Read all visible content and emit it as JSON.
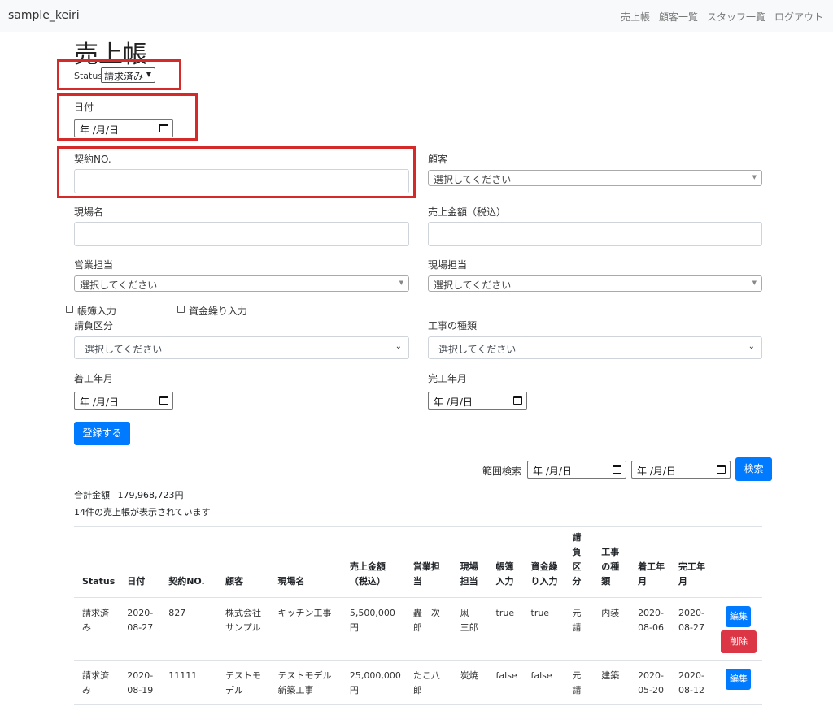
{
  "navbar": {
    "brand": "sample_keiri",
    "links": [
      "売上帳",
      "顧客一覧",
      "スタッフ一覧",
      "ログアウト"
    ]
  },
  "page_title": "売上帳",
  "status_filter": {
    "label": "Status",
    "value": "請求済み"
  },
  "form": {
    "date_label": "日付",
    "date_value": "年 /月/日",
    "contract_label": "契約NO.",
    "customer_label": "顧客",
    "customer_value": "選択してください",
    "site_label": "現場名",
    "amount_label": "売上金額（税込）",
    "sales_staff_label": "営業担当",
    "sales_staff_value": "選択してください",
    "site_staff_label": "現場担当",
    "site_staff_value": "選択してください",
    "ledger_check_label": "帳簿入力",
    "fund_check_label": "資金繰り入力",
    "contract_type_label": "請負区分",
    "contract_type_value": "選択してください",
    "work_type_label": "工事の種類",
    "work_type_value": "選択してください",
    "start_label": "着工年月",
    "start_value": "年 /月/日",
    "end_label": "完工年月",
    "end_value": "年 /月/日",
    "submit_label": "登録する"
  },
  "range_search": {
    "label": "範囲検索",
    "from_value": "年 /月/日",
    "to_value": "年 /月/日",
    "button_label": "検索"
  },
  "summary": {
    "total_label": "合計金額",
    "total_value": "179,968,723円",
    "count_text": "14件の売上帳が表示されています"
  },
  "table": {
    "headers": [
      "Status",
      "日付",
      "契約NO.",
      "顧客",
      "現場名",
      "売上金額（税込）",
      "営業担当",
      "現場担当",
      "帳簿入力",
      "資金繰り入力",
      "請負区分",
      "工事の種類",
      "着工年月",
      "完工年月"
    ],
    "rows": [
      {
        "status": "請求済み",
        "date": "2020-08-27",
        "contract": "827",
        "customer": "株式会社サンプル",
        "site": "キッチン工事",
        "amount": "5,500,000円",
        "sales_staff": "轟　次郎",
        "site_staff": "凩　三郎",
        "ledger": "true",
        "fund": "true",
        "contract_type": "元請",
        "work_type": "内装",
        "start": "2020-08-06",
        "end": "2020-08-27",
        "edit": "編集",
        "delete": "削除"
      },
      {
        "status": "請求済み",
        "date": "2020-08-19",
        "contract": "11111",
        "customer": "テストモデル",
        "site": "テストモデル新築工事",
        "amount": "25,000,000円",
        "sales_staff": "たこ八郎",
        "site_staff": "炭焼",
        "ledger": "false",
        "fund": "false",
        "contract_type": "元請",
        "work_type": "建築",
        "start": "2020-05-20",
        "end": "2020-08-12",
        "edit": "編集"
      }
    ]
  },
  "colors": {
    "primary": "#007bff",
    "danger": "#dc3545",
    "highlight": "#d42a2a"
  }
}
